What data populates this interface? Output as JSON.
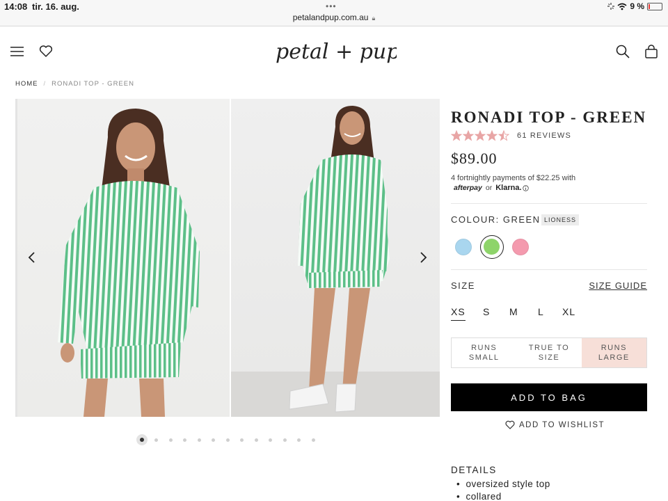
{
  "status_bar": {
    "time": "14:08",
    "date": "tir. 16. aug.",
    "url": "petalandpup.com.au",
    "battery": "9 %",
    "battery_level": 0.09
  },
  "header": {
    "logo_text": "petal + pup",
    "icons": [
      "menu-icon",
      "heart-icon",
      "search-icon",
      "bag-icon"
    ]
  },
  "breadcrumb": {
    "home": "HOME",
    "separator": "/",
    "current": "RONADI TOP - GREEN"
  },
  "gallery": {
    "dot_count": 13,
    "active_index": 0
  },
  "product": {
    "title": "RONADI TOP - GREEN",
    "rating": 4.5,
    "reviews": "61 REVIEWS",
    "price": "$89.00",
    "payments_text": "4 fortnightly payments of $22.25 with",
    "afterpay": "afterpay",
    "or": "or",
    "klarna": "Klarna.",
    "colour_label": "COLOUR: GREEN",
    "colour_badge": "LIONESS",
    "swatches": [
      {
        "name": "blue",
        "color": "#a9d6ef"
      },
      {
        "name": "green",
        "color": "#8ed46a",
        "selected": true
      },
      {
        "name": "pink",
        "color": "#f49aae"
      }
    ],
    "size_label": "SIZE",
    "size_guide": "SIZE GUIDE",
    "sizes": [
      "XS",
      "S",
      "M",
      "L",
      "XL"
    ],
    "selected_size": "XS",
    "fit": [
      {
        "line1": "RUNS",
        "line2": "SMALL"
      },
      {
        "line1": "TRUE TO",
        "line2": "SIZE"
      },
      {
        "line1": "RUNS",
        "line2": "LARGE",
        "active": true
      }
    ],
    "add_to_bag": "ADD TO BAG",
    "add_to_wishlist": "ADD TO WISHLIST",
    "details_heading": "DETAILS",
    "details": [
      "oversized style top",
      "collared"
    ]
  },
  "colors": {
    "fit_active_bg": "#f7dfd8",
    "star": "#e8a5a5",
    "button_bg": "#000000"
  }
}
